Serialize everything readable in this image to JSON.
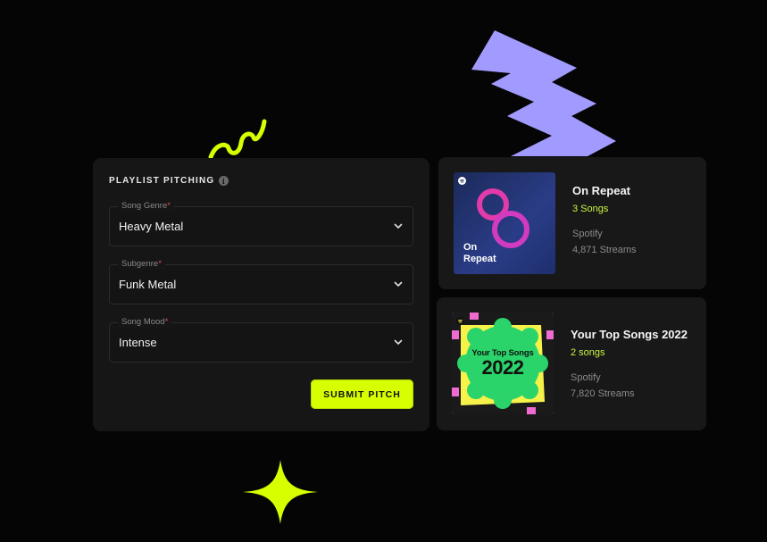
{
  "pitch_form": {
    "title": "PLAYLIST PITCHING",
    "info_icon": "info-icon",
    "fields": [
      {
        "label": "Song Genre",
        "required_mark": "*",
        "value": "Heavy Metal"
      },
      {
        "label": "Subgenre",
        "required_mark": "*",
        "value": "Funk Metal"
      },
      {
        "label": "Song Mood",
        "required_mark": "*",
        "value": "Intense"
      }
    ],
    "submit_label": "SUBMIT PITCH"
  },
  "playlists": [
    {
      "title": "On Repeat",
      "count": "3 Songs",
      "platform": "Spotify",
      "streams": "4,871 Streams",
      "cover_text_1": "On",
      "cover_text_2": "Repeat"
    },
    {
      "title": "Your Top Songs 2022",
      "count": "2 songs",
      "platform": "Spotify",
      "streams": "7,820 Streams",
      "cover_text_1": "Your Top Songs",
      "cover_text_2": "2022"
    }
  ],
  "colors": {
    "accent": "#d7ff00",
    "background": "#050505",
    "panel": "#161616",
    "lilac_zigzag": "#a29bff"
  }
}
